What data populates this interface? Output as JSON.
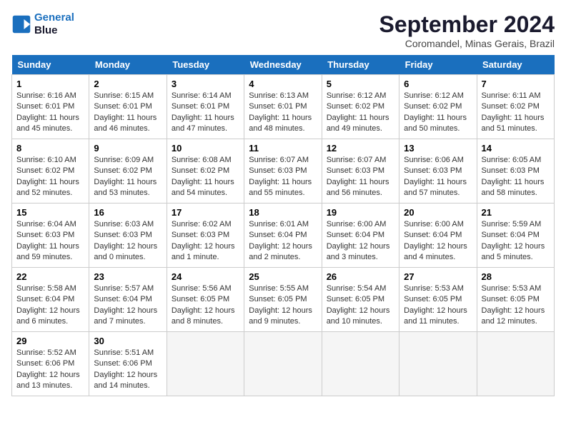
{
  "header": {
    "logo_line1": "General",
    "logo_line2": "Blue",
    "month": "September 2024",
    "location": "Coromandel, Minas Gerais, Brazil"
  },
  "weekdays": [
    "Sunday",
    "Monday",
    "Tuesday",
    "Wednesday",
    "Thursday",
    "Friday",
    "Saturday"
  ],
  "weeks": [
    [
      {
        "day": "1",
        "sunrise": "6:16 AM",
        "sunset": "6:01 PM",
        "daylight": "11 hours and 45 minutes."
      },
      {
        "day": "2",
        "sunrise": "6:15 AM",
        "sunset": "6:01 PM",
        "daylight": "11 hours and 46 minutes."
      },
      {
        "day": "3",
        "sunrise": "6:14 AM",
        "sunset": "6:01 PM",
        "daylight": "11 hours and 47 minutes."
      },
      {
        "day": "4",
        "sunrise": "6:13 AM",
        "sunset": "6:01 PM",
        "daylight": "11 hours and 48 minutes."
      },
      {
        "day": "5",
        "sunrise": "6:12 AM",
        "sunset": "6:02 PM",
        "daylight": "11 hours and 49 minutes."
      },
      {
        "day": "6",
        "sunrise": "6:12 AM",
        "sunset": "6:02 PM",
        "daylight": "11 hours and 50 minutes."
      },
      {
        "day": "7",
        "sunrise": "6:11 AM",
        "sunset": "6:02 PM",
        "daylight": "11 hours and 51 minutes."
      }
    ],
    [
      {
        "day": "8",
        "sunrise": "6:10 AM",
        "sunset": "6:02 PM",
        "daylight": "11 hours and 52 minutes."
      },
      {
        "day": "9",
        "sunrise": "6:09 AM",
        "sunset": "6:02 PM",
        "daylight": "11 hours and 53 minutes."
      },
      {
        "day": "10",
        "sunrise": "6:08 AM",
        "sunset": "6:02 PM",
        "daylight": "11 hours and 54 minutes."
      },
      {
        "day": "11",
        "sunrise": "6:07 AM",
        "sunset": "6:03 PM",
        "daylight": "11 hours and 55 minutes."
      },
      {
        "day": "12",
        "sunrise": "6:07 AM",
        "sunset": "6:03 PM",
        "daylight": "11 hours and 56 minutes."
      },
      {
        "day": "13",
        "sunrise": "6:06 AM",
        "sunset": "6:03 PM",
        "daylight": "11 hours and 57 minutes."
      },
      {
        "day": "14",
        "sunrise": "6:05 AM",
        "sunset": "6:03 PM",
        "daylight": "11 hours and 58 minutes."
      }
    ],
    [
      {
        "day": "15",
        "sunrise": "6:04 AM",
        "sunset": "6:03 PM",
        "daylight": "11 hours and 59 minutes."
      },
      {
        "day": "16",
        "sunrise": "6:03 AM",
        "sunset": "6:03 PM",
        "daylight": "12 hours and 0 minutes."
      },
      {
        "day": "17",
        "sunrise": "6:02 AM",
        "sunset": "6:03 PM",
        "daylight": "12 hours and 1 minute."
      },
      {
        "day": "18",
        "sunrise": "6:01 AM",
        "sunset": "6:04 PM",
        "daylight": "12 hours and 2 minutes."
      },
      {
        "day": "19",
        "sunrise": "6:00 AM",
        "sunset": "6:04 PM",
        "daylight": "12 hours and 3 minutes."
      },
      {
        "day": "20",
        "sunrise": "6:00 AM",
        "sunset": "6:04 PM",
        "daylight": "12 hours and 4 minutes."
      },
      {
        "day": "21",
        "sunrise": "5:59 AM",
        "sunset": "6:04 PM",
        "daylight": "12 hours and 5 minutes."
      }
    ],
    [
      {
        "day": "22",
        "sunrise": "5:58 AM",
        "sunset": "6:04 PM",
        "daylight": "12 hours and 6 minutes."
      },
      {
        "day": "23",
        "sunrise": "5:57 AM",
        "sunset": "6:04 PM",
        "daylight": "12 hours and 7 minutes."
      },
      {
        "day": "24",
        "sunrise": "5:56 AM",
        "sunset": "6:05 PM",
        "daylight": "12 hours and 8 minutes."
      },
      {
        "day": "25",
        "sunrise": "5:55 AM",
        "sunset": "6:05 PM",
        "daylight": "12 hours and 9 minutes."
      },
      {
        "day": "26",
        "sunrise": "5:54 AM",
        "sunset": "6:05 PM",
        "daylight": "12 hours and 10 minutes."
      },
      {
        "day": "27",
        "sunrise": "5:53 AM",
        "sunset": "6:05 PM",
        "daylight": "12 hours and 11 minutes."
      },
      {
        "day": "28",
        "sunrise": "5:53 AM",
        "sunset": "6:05 PM",
        "daylight": "12 hours and 12 minutes."
      }
    ],
    [
      {
        "day": "29",
        "sunrise": "5:52 AM",
        "sunset": "6:06 PM",
        "daylight": "12 hours and 13 minutes."
      },
      {
        "day": "30",
        "sunrise": "5:51 AM",
        "sunset": "6:06 PM",
        "daylight": "12 hours and 14 minutes."
      },
      null,
      null,
      null,
      null,
      null
    ]
  ]
}
